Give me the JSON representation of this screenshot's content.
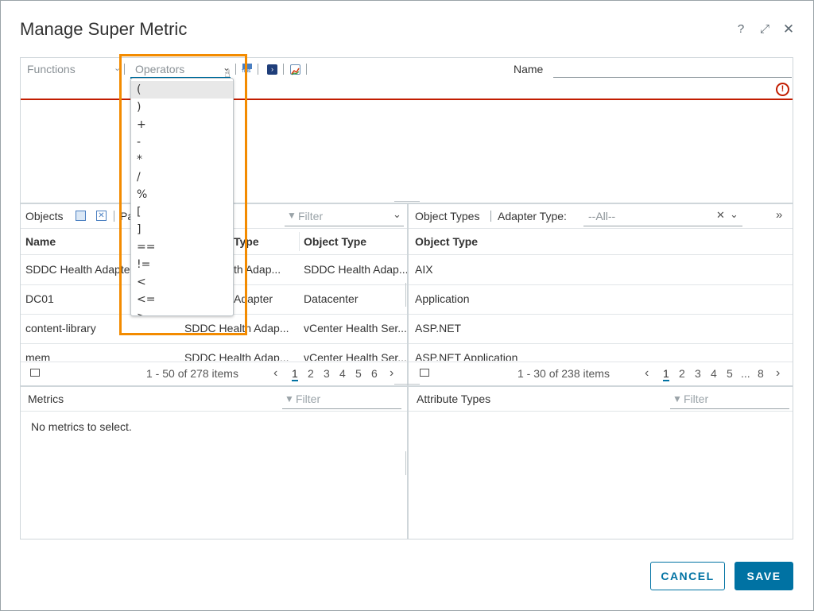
{
  "dialog": {
    "title": "Manage Super Metric",
    "help_icon": "?",
    "expand_icon": "⤢",
    "close_icon": "✕"
  },
  "toolbar": {
    "functions_placeholder": "Functions",
    "operators_placeholder": "Operators",
    "this_label": "THIS",
    "name_label": "Name",
    "error_icon": "!"
  },
  "operators_dropdown": {
    "items": [
      "(",
      ")",
      "+",
      "-",
      "*",
      "/",
      "%",
      "[",
      "]",
      "==",
      "!=",
      "<",
      "<=",
      ">"
    ]
  },
  "objects_panel": {
    "label": "Objects",
    "partial_label": "Pa",
    "filter_placeholder": "Filter",
    "columns": [
      "Name",
      "Type",
      "Object Type"
    ],
    "rows": [
      {
        "name": "SDDC Health Adapter",
        "adapter": "th Adap...",
        "type": "SDDC Health Adap..."
      },
      {
        "name": "DC01",
        "adapter": "Adapter",
        "type": "Datacenter"
      },
      {
        "name": "content-library",
        "adapter": "SDDC Health Adap...",
        "type": "vCenter Health Ser..."
      },
      {
        "name": "mem",
        "adapter": "SDDC Health Adap...",
        "type": "vCenter Health Ser..."
      }
    ],
    "pager_summary": "1 - 50 of 278 items",
    "pages": [
      "1",
      "2",
      "3",
      "4",
      "5",
      "6"
    ]
  },
  "object_types_panel": {
    "label": "Object Types",
    "adapter_type_label": "Adapter Type:",
    "adapter_type_value": "--All--",
    "column": "Object Type",
    "rows": [
      "AIX",
      "Application",
      "ASP.NET",
      "ASP.NET Application"
    ],
    "pager_summary": "1 - 30 of 238 items",
    "pages": [
      "1",
      "2",
      "3",
      "4",
      "5",
      "...",
      "8"
    ]
  },
  "metrics_panel": {
    "label": "Metrics",
    "filter_placeholder": "Filter",
    "empty_text": "No metrics to select."
  },
  "attribute_types_panel": {
    "label": "Attribute Types",
    "filter_placeholder": "Filter"
  },
  "footer": {
    "cancel_label": "CANCEL",
    "save_label": "SAVE"
  },
  "colors": {
    "accent": "#0072a3",
    "error": "#c21d00",
    "highlight": "#f38b00"
  }
}
